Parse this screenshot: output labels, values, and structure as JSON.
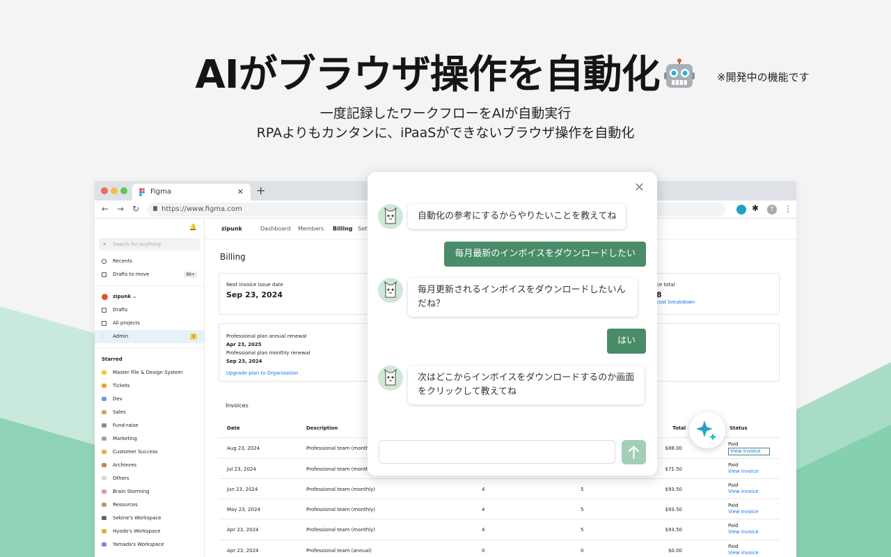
{
  "hero": {
    "title": "AIがブラウザ操作を自動化",
    "dev_note": "※開発中の機能です",
    "subtitle_1": "一度記録したワークフローをAIが自動実行",
    "subtitle_2": "RPAよりもカンタンに、iPaaSができないブラウザ操作を自動化",
    "robot_icon": "robot-icon"
  },
  "browser": {
    "tab_title": "Figma",
    "url": "https://www.figma.com",
    "icons": [
      "back-icon",
      "forward-icon",
      "reload-icon",
      "lock-icon",
      "extension-icon",
      "puzzle-icon",
      "profile-icon",
      "menu-icon"
    ],
    "profile_initial": "T"
  },
  "sidebar": {
    "search_placeholder": "Search for anything",
    "top_items": [
      {
        "label": "Recents",
        "badge": ""
      },
      {
        "label": "Drafts to move",
        "badge": "99+"
      }
    ],
    "team_name": "zipunk",
    "team_items": [
      {
        "label": "Drafts",
        "badge": ""
      },
      {
        "label": "All projects",
        "badge": ""
      },
      {
        "label": "Admin",
        "badge": "1"
      }
    ],
    "starred_heading": "Starred",
    "starred": [
      "Master File & Design System",
      "Tickets",
      "Dev",
      "Sales",
      "Fund-raise",
      "Marketing",
      "Customer Success",
      "Archieves",
      "Others",
      "Brain Storming",
      "Resources",
      "Sekine's Workspace",
      "Hyodo's Workspace",
      "Yamada's Workspace"
    ]
  },
  "topnav": {
    "team": "zipunk",
    "items": [
      "Dashboard",
      "Members",
      "Billing",
      "Sett"
    ]
  },
  "billing": {
    "title": "Billing",
    "next_invoice_label": "Next invoice issue date",
    "next_invoice_date": "Sep 23, 2024",
    "total_label": "ce total",
    "total_value": "8",
    "cost_link": "cost breakdown",
    "plan_annual_label": "Professional plan annual renewal",
    "plan_annual_date": "Apr 23, 2025",
    "plan_monthly_label": "Professional plan monthly renewal",
    "plan_monthly_date": "Sep 23, 2024",
    "upgrade_link": "Upgrade plan to Organization"
  },
  "invoices": {
    "title": "Invoices",
    "headers": [
      "Date",
      "Description",
      "",
      "",
      "Total",
      "Status"
    ],
    "rows": [
      {
        "date": "Aug 23, 2024",
        "desc": "Professional team (monthly)",
        "a": "",
        "b": "",
        "total": "$88.00",
        "status": "Paid",
        "link": "View invoice"
      },
      {
        "date": "Jul 23, 2024",
        "desc": "Professional team (monthly)",
        "a": "",
        "b": "",
        "total": "$71.50",
        "status": "Paid",
        "link": "View invoice"
      },
      {
        "date": "Jun 23, 2024",
        "desc": "Professional team (monthly)",
        "a": "4",
        "b": "5",
        "total": "$93.50",
        "status": "Paid",
        "link": "View invoice"
      },
      {
        "date": "May 23, 2024",
        "desc": "Professional team (monthly)",
        "a": "4",
        "b": "5",
        "total": "$93.50",
        "status": "Paid",
        "link": "View invoice"
      },
      {
        "date": "Apr 23, 2024",
        "desc": "Professional team (monthly)",
        "a": "4",
        "b": "5",
        "total": "$93.50",
        "status": "Paid",
        "link": "View invoice"
      },
      {
        "date": "Apr 23, 2024",
        "desc": "Professional team (annual)",
        "a": "0",
        "b": "0",
        "total": "$0.00",
        "status": "Paid",
        "link": "View invoice"
      }
    ]
  },
  "chat": {
    "messages": [
      {
        "role": "bot",
        "text": "自動化の参考にするからやりたいことを教えてね"
      },
      {
        "role": "user",
        "text": "毎月最新のインボイスをダウンロードしたい"
      },
      {
        "role": "bot",
        "text": "毎月更新されるインボイスをダウンロードしたいんだね？"
      },
      {
        "role": "user",
        "text": "はい"
      },
      {
        "role": "bot",
        "text": "次はどこからインボイスをダウンロードするのか画面をクリックして教えてね"
      }
    ],
    "input_value": "",
    "colors": {
      "user_bubble": "#4a8c68",
      "send_button": "#a3cfb4",
      "accent": "#21a0c4"
    }
  }
}
